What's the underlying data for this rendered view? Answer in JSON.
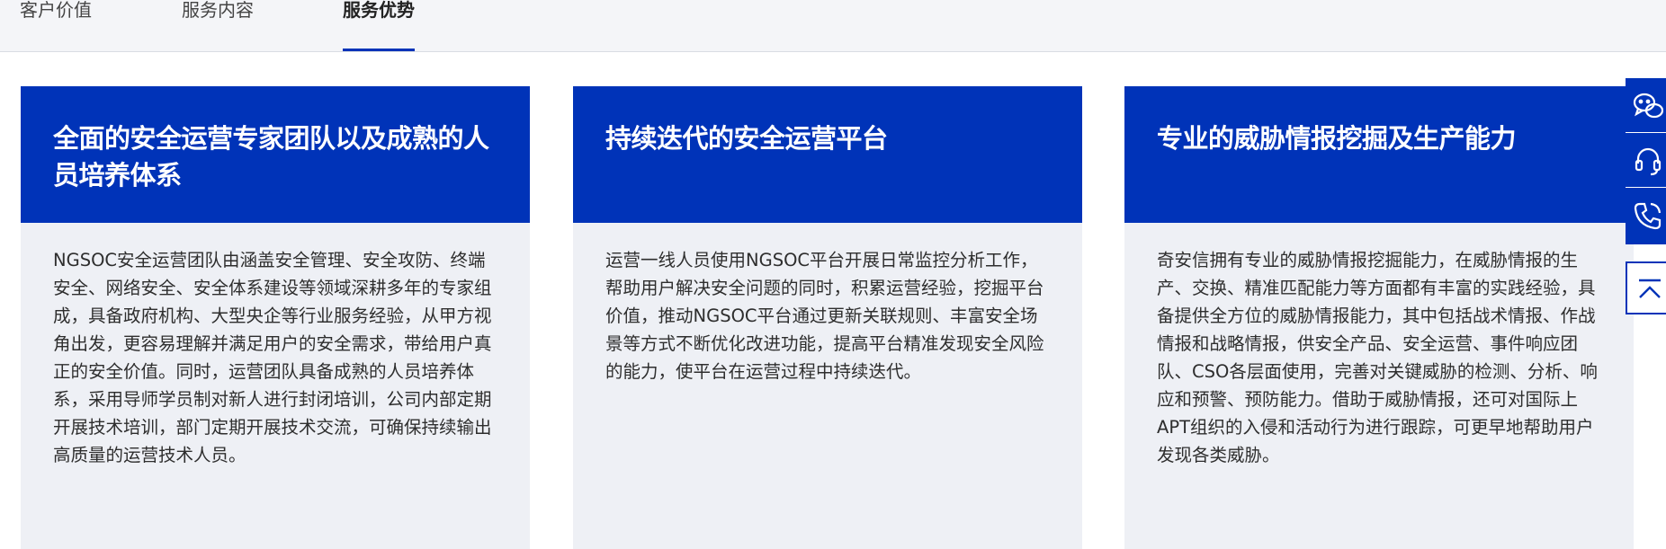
{
  "tabs": [
    {
      "label": "客户价值"
    },
    {
      "label": "服务内容"
    },
    {
      "label": "服务优势"
    }
  ],
  "active_tab": "服务优势",
  "cards": [
    {
      "title": "全面的安全运营专家团队以及成熟的人员培养体系",
      "body": "NGSOC安全运营团队由涵盖安全管理、安全攻防、终端安全、网络安全、安全体系建设等领域深耕多年的专家组成，具备政府机构、大型央企等行业服务经验，从甲方视角出发，更容易理解并满足用户的安全需求，带给用户真正的安全价值。同时，运营团队具备成熟的人员培养体系，采用导师学员制对新人进行封闭培训，公司内部定期开展技术培训，部门定期开展技术交流，可确保持续输出高质量的运营技术人员。"
    },
    {
      "title": "持续迭代的安全运营平台",
      "body": "运营一线人员使用NGSOC平台开展日常监控分析工作，帮助用户解决安全问题的同时，积累运营经验，挖掘平台价值，推动NGSOC平台通过更新关联规则、丰富安全场景等方式不断优化改进功能，提高平台精准发现安全风险的能力，使平台在运营过程中持续迭代。"
    },
    {
      "title": "专业的威胁情报挖掘及生产能力",
      "body": "奇安信拥有专业的威胁情报挖掘能力，在威胁情报的生产、交换、精准匹配能力等方面都有丰富的实践经验，具备提供全方位的威胁情报能力，其中包括战术情报、作战情报和战略情报，供安全产品、安全运营、事件响应团队、CSO各层面使用，完善对关键威胁的检测、分析、响应和预警、预防能力。借助于威胁情报，还可对国际上APT组织的入侵和活动行为进行跟踪，可更早地帮助用户发现各类威胁。"
    }
  ],
  "sidebar": {
    "icons": [
      "wechat-icon",
      "headset-icon",
      "phone-icon"
    ],
    "totop_icon": "arrow-up-icon"
  },
  "colors": {
    "accent": "#0033b8",
    "card_bg": "#eef0f5",
    "tabbar_bg": "#f4f5f8"
  }
}
